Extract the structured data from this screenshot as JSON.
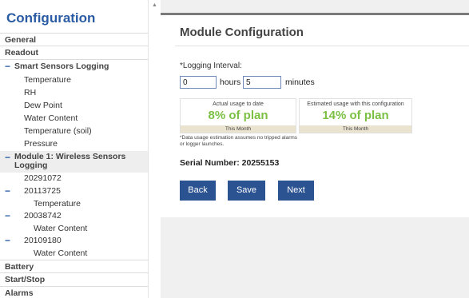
{
  "sidebar": {
    "title": "Configuration",
    "general": "General",
    "readout": "Readout",
    "smart_group": "Smart Sensors Logging",
    "smart_items": [
      "Temperature",
      "RH",
      "Dew Point",
      "Water Content",
      "Temperature (soil)",
      "Pressure"
    ],
    "module_group": "Module 1: Wireless Sensors Logging",
    "module_serial_1": "20291072",
    "module_serial_2": "20113725",
    "module_serial_2_sub": "Temperature",
    "module_serial_3": "20038742",
    "module_serial_3_sub": "Water Content",
    "module_serial_4": "20109180",
    "module_serial_4_sub": "Water Content",
    "battery": "Battery",
    "startstop": "Start/Stop",
    "alarms": "Alarms",
    "minus_glyph": "−"
  },
  "main": {
    "title": "Module Configuration",
    "interval_label": "*Logging Interval:",
    "hours_value": "0",
    "hours_unit": "hours",
    "minutes_value": "5",
    "minutes_unit": "minutes",
    "usage_actual": {
      "caption": "Actual usage to date",
      "value": "8% of plan",
      "footer": "This Month"
    },
    "usage_estimated": {
      "caption": "Estimated usage with this configuration",
      "value": "14% of plan",
      "footer": "This Month"
    },
    "footnote": "*Data usage estimation assumes no tripped alarms or logger launches.",
    "serial": "Serial Number: 20255153",
    "buttons": {
      "back": "Back",
      "save": "Save",
      "next": "Next"
    }
  },
  "colors": {
    "accent_blue": "#2a5ba3",
    "button_blue": "#2b5291",
    "usage_green": "#7bc043"
  },
  "icons": {
    "scroll_up": "scroll-up-arrow-icon",
    "collapse": "minus-collapse-icon"
  }
}
